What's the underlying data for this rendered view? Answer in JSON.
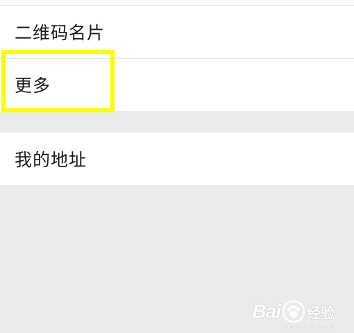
{
  "settings_list": {
    "group_1": {
      "items": [
        {
          "label": "二维码名片"
        },
        {
          "label": "更多"
        }
      ]
    },
    "group_2": {
      "items": [
        {
          "label": "我的地址"
        }
      ]
    }
  },
  "highlight": {
    "target": "更多",
    "color": "#fdfd00"
  },
  "watermark": {
    "brand_text": "Bai",
    "brand_suffix": "经验",
    "url": "jingyan.baidu.com"
  },
  "colors": {
    "background": "#ebebeb",
    "row_background": "#ffffff",
    "divider": "#e2e2e2",
    "text": "#1a1a1a"
  }
}
